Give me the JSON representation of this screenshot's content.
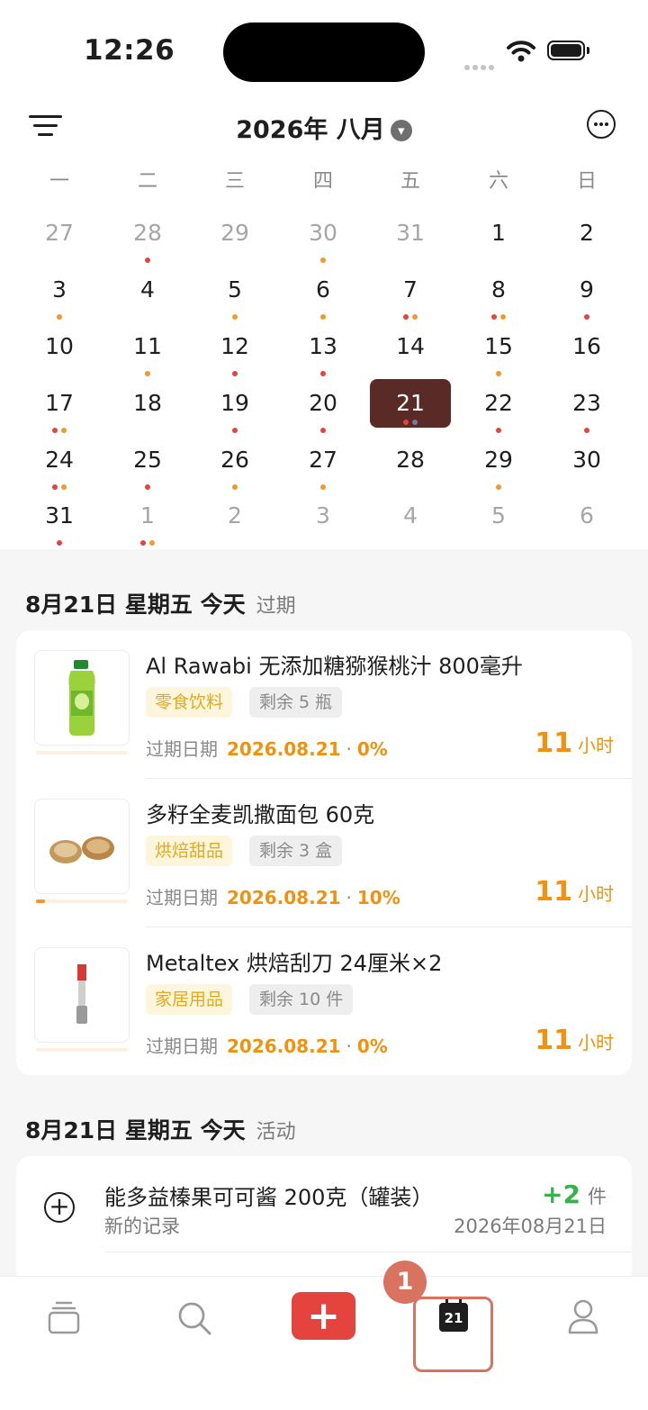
{
  "status_bar": {
    "time": "12:26"
  },
  "header": {
    "title": "2026年 八月",
    "chevron": "⌄"
  },
  "weekdays": [
    "一",
    "二",
    "三",
    "四",
    "五",
    "六",
    "日"
  ],
  "calendar": {
    "weeks": [
      [
        {
          "n": "27",
          "dim": true,
          "dots": []
        },
        {
          "n": "28",
          "dim": true,
          "dots": [
            "#e5433d"
          ]
        },
        {
          "n": "29",
          "dim": true,
          "dots": []
        },
        {
          "n": "30",
          "dim": true,
          "dots": [
            "#f09a2c"
          ]
        },
        {
          "n": "31",
          "dim": true,
          "dots": []
        },
        {
          "n": "1",
          "dots": []
        },
        {
          "n": "2",
          "dots": []
        }
      ],
      [
        {
          "n": "3",
          "dots": [
            "#f09a2c"
          ]
        },
        {
          "n": "4",
          "dots": []
        },
        {
          "n": "5",
          "dots": [
            "#f09a2c"
          ]
        },
        {
          "n": "6",
          "dots": [
            "#f09a2c"
          ]
        },
        {
          "n": "7",
          "dots": [
            "#e5433d",
            "#f09a2c"
          ]
        },
        {
          "n": "8",
          "dots": [
            "#e5433d",
            "#f09a2c"
          ]
        },
        {
          "n": "9",
          "dots": [
            "#e5433d"
          ]
        }
      ],
      [
        {
          "n": "10",
          "dots": []
        },
        {
          "n": "11",
          "dots": [
            "#f09a2c"
          ]
        },
        {
          "n": "12",
          "dots": [
            "#e5433d"
          ]
        },
        {
          "n": "13",
          "dots": [
            "#e5433d"
          ]
        },
        {
          "n": "14",
          "dots": []
        },
        {
          "n": "15",
          "dots": [
            "#f09a2c"
          ]
        },
        {
          "n": "16",
          "dots": []
        }
      ],
      [
        {
          "n": "17",
          "dots": [
            "#e5433d",
            "#f09a2c"
          ]
        },
        {
          "n": "18",
          "dots": []
        },
        {
          "n": "19",
          "dots": [
            "#e5433d"
          ]
        },
        {
          "n": "20",
          "dots": [
            "#e5433d"
          ]
        },
        {
          "n": "21",
          "selected": true,
          "dots": [
            "#e5433d",
            "#6f7fa0"
          ]
        },
        {
          "n": "22",
          "dots": [
            "#e5433d"
          ]
        },
        {
          "n": "23",
          "dots": [
            "#e5433d"
          ]
        }
      ],
      [
        {
          "n": "24",
          "dots": [
            "#e5433d",
            "#f09a2c"
          ]
        },
        {
          "n": "25",
          "dots": [
            "#e5433d"
          ]
        },
        {
          "n": "26",
          "dots": [
            "#f09a2c"
          ]
        },
        {
          "n": "27",
          "dots": [
            "#f09a2c"
          ]
        },
        {
          "n": "28",
          "dots": []
        },
        {
          "n": "29",
          "dots": [
            "#f09a2c"
          ]
        },
        {
          "n": "30",
          "dots": []
        }
      ],
      [
        {
          "n": "31",
          "dots": [
            "#e5433d"
          ]
        },
        {
          "n": "1",
          "dim": true,
          "dots": [
            "#e5433d",
            "#f09a2c"
          ]
        },
        {
          "n": "2",
          "dim": true,
          "dots": []
        },
        {
          "n": "3",
          "dim": true,
          "dots": []
        },
        {
          "n": "4",
          "dim": true,
          "dots": []
        },
        {
          "n": "5",
          "dim": true,
          "dots": []
        },
        {
          "n": "6",
          "dim": true,
          "dots": []
        }
      ]
    ]
  },
  "expired_section": {
    "date": "8月21日 星期五 今天",
    "label": "过期",
    "items": [
      {
        "name": "Al Rawabi 无添加糖猕猴桃汁 800毫升",
        "category": "零食饮料",
        "remaining": "剩余 5 瓶",
        "expiry_label": "过期日期",
        "expiry_date": "2026.08.21",
        "dot": "·",
        "percent": "0%",
        "progress": 0,
        "hours": "11",
        "hours_unit": "小时"
      },
      {
        "name": "多籽全麦凯撒面包 60克",
        "category": "烘焙甜品",
        "remaining": "剩余 3 盒",
        "expiry_label": "过期日期",
        "expiry_date": "2026.08.21",
        "dot": "·",
        "percent": "10%",
        "progress": 0.1,
        "hours": "11",
        "hours_unit": "小时"
      },
      {
        "name": "Metaltex 烘焙刮刀 24厘米×2",
        "category": "家居用品",
        "remaining": "剩余 10 件",
        "expiry_label": "过期日期",
        "expiry_date": "2026.08.21",
        "dot": "·",
        "percent": "0%",
        "progress": 0,
        "hours": "11",
        "hours_unit": "小时"
      }
    ]
  },
  "activity_section": {
    "date": "8月21日 星期五 今天",
    "label": "活动",
    "items": [
      {
        "name": "能多益榛果可可酱 200克（罐装）",
        "sub": "新的记录",
        "qty": "+2",
        "unit": "件",
        "date": "2026年08月21日"
      }
    ]
  },
  "tabbar": {
    "calendar_day": "21",
    "badge": "1",
    "add": "+"
  },
  "colors": {
    "accent": "#e5433d",
    "warning": "#f09a2c",
    "selected_day": "#5a2a26",
    "positive": "#37b24d"
  }
}
